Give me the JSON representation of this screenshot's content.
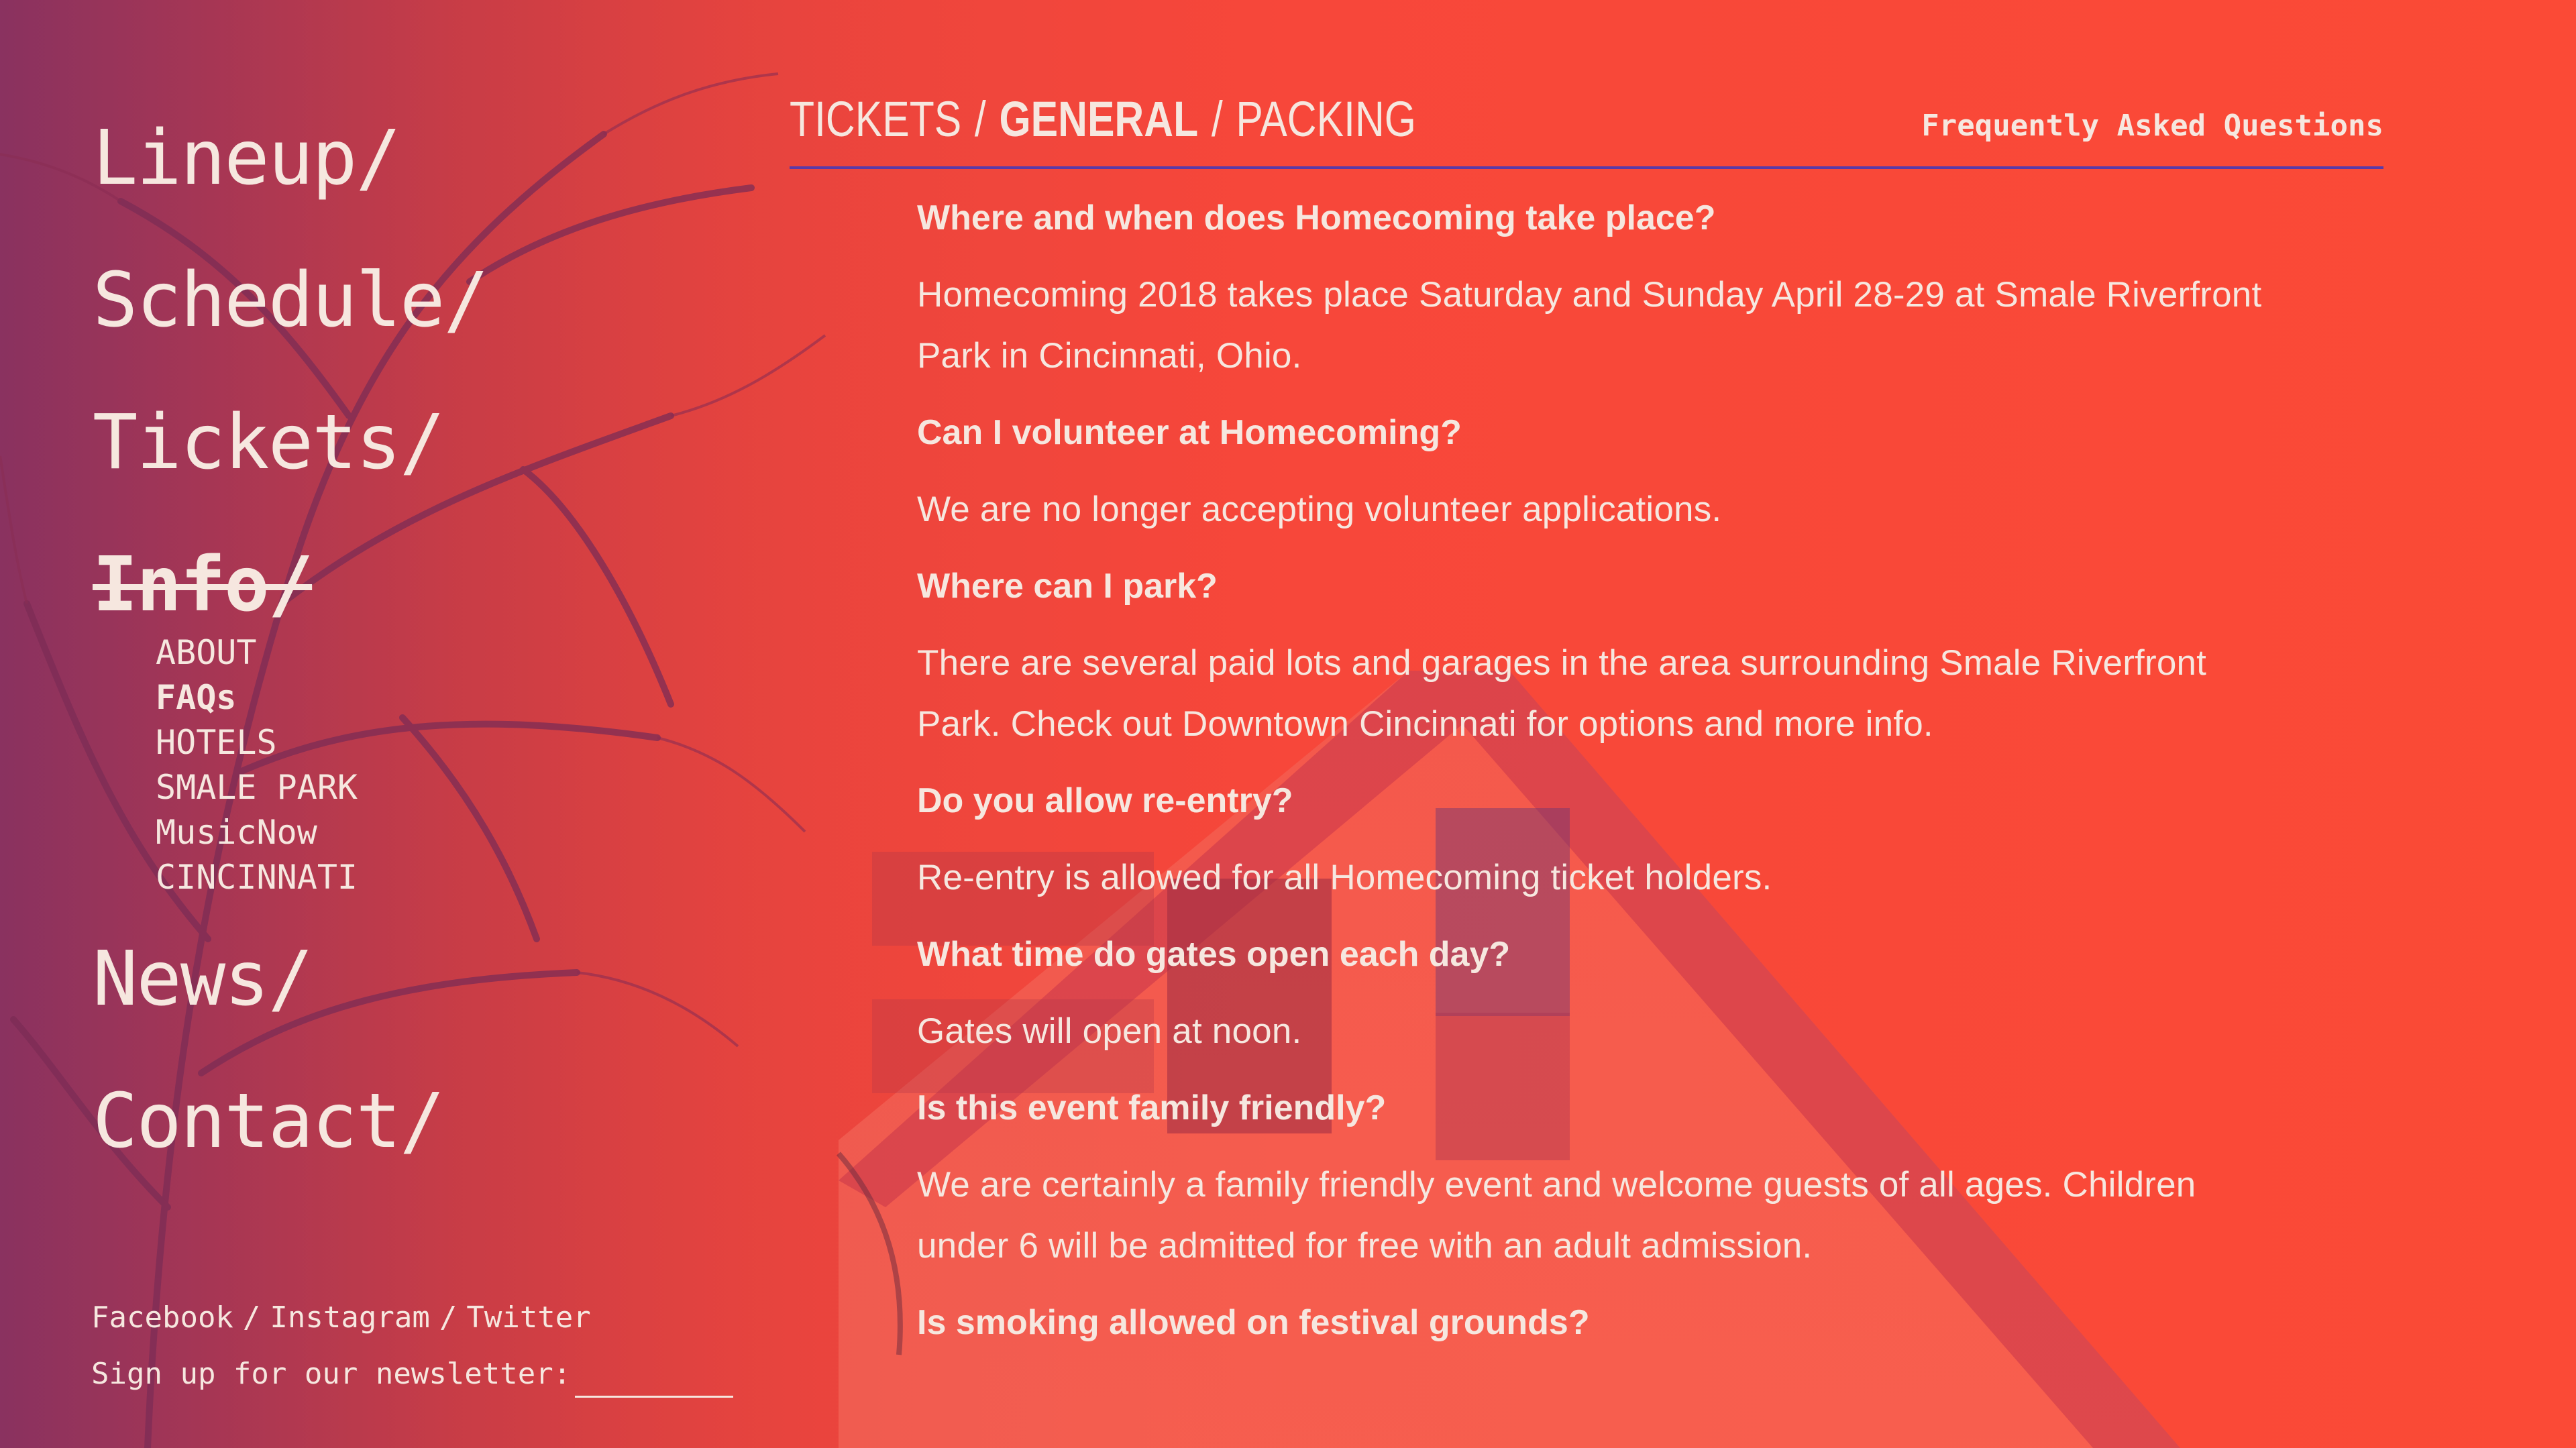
{
  "nav": {
    "items": [
      {
        "label": "Lineup/"
      },
      {
        "label": "Schedule/"
      },
      {
        "label": "Tickets/"
      },
      {
        "label": "Info/"
      },
      {
        "label": "News/"
      },
      {
        "label": "Contact/"
      }
    ],
    "info_sub": [
      {
        "label": "ABOUT"
      },
      {
        "label": "FAQs"
      },
      {
        "label": "HOTELS"
      },
      {
        "label": "SMALE PARK"
      },
      {
        "label": "MusicNow"
      },
      {
        "label": "CINCINNATI"
      }
    ]
  },
  "footer": {
    "social": [
      "Facebook",
      "Instagram",
      "Twitter"
    ],
    "separator": "/",
    "newsletter_label": "Sign up for our newsletter:"
  },
  "header": {
    "tabs": [
      "TICKETS",
      "GENERAL",
      "PACKING"
    ],
    "tab_separator": "/",
    "page_label": "Frequently Asked Questions"
  },
  "faqs": [
    {
      "q": "Where and when does Homecoming take place?",
      "a": "Homecoming 2018 takes place Saturday and Sunday April 28-29 at Smale Riverfront Park in Cincinnati, Ohio."
    },
    {
      "q": "Can I volunteer at Homecoming?",
      "a": "We are no longer accepting volunteer applications."
    },
    {
      "q": "Where can I park?",
      "a": "There are several paid lots and garages in the area surrounding Smale Riverfront Park. Check out Downtown Cincinnati for options and more info."
    },
    {
      "q": "Do you allow re-entry?",
      "a": "Re-entry is allowed for all Homecoming ticket holders."
    },
    {
      "q": "What time do gates open each day?",
      "a": "Gates will open at noon."
    },
    {
      "q": "Is this event family friendly?",
      "a": "We are certainly a family friendly event and welcome guests of all ages. Children under 6 will be admitted for free with an adult admission."
    },
    {
      "q": "Is smoking allowed on festival grounds?",
      "a": ""
    }
  ],
  "colors": {
    "background": "#f7473a",
    "text": "#f6e4dd",
    "divider": "#5b3aa7"
  }
}
